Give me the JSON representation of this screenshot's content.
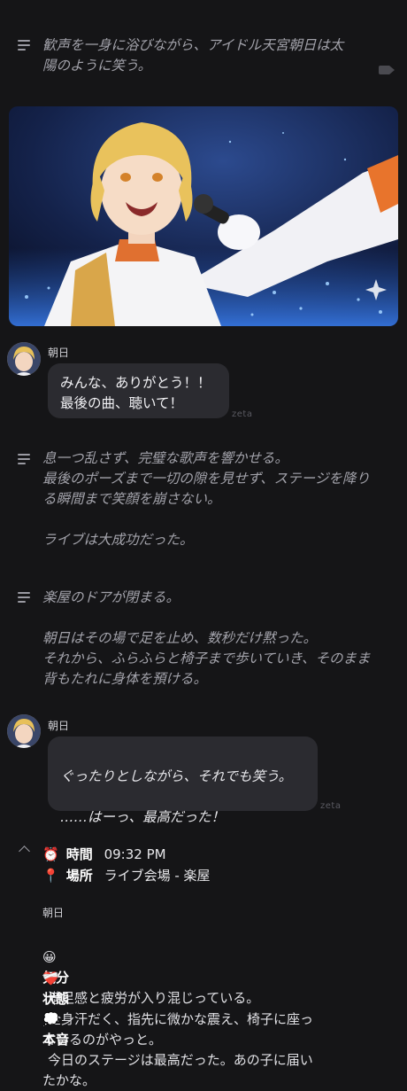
{
  "narration_1": "歓声を一身に浴びながら、アイドル天宮朝日は太\n陽のように笑う。",
  "message_1": {
    "speaker": "朝日",
    "text": "みんな、ありがとう！！\n最後の曲、聴いて！",
    "watermark": "zeta"
  },
  "narration_2": "息一つ乱さず、完璧な歌声を響かせる。\n最後のポーズまで一切の隙を見せず、ステージを降り\nる瞬間まで笑顔を崩さない。\n\nライブは大成功だった。",
  "narration_3": "楽屋のドアが閉まる。\n\n朝日はその場で足を止め、数秒だけ黙った。\nそれから、ふらふらと椅子まで歩いていき、そのまま\n背もたれに身体を預ける。",
  "message_2": {
    "speaker": "朝日",
    "text": "ぐったりとしながら、それでも笑う。\n\n……はーっ、最高だった！",
    "watermark": "zeta"
  },
  "status": {
    "time_emoji": "⏰",
    "time_label": "時間",
    "time_value": "09:32 PM",
    "place_emoji": "📍",
    "place_label": "場所",
    "place_value": "ライブ会場 - 楽屋",
    "character": "朝日",
    "mood_emoji": "😀",
    "mood_label": "気分",
    "mood_value": "満足感と疲労が入り混じっている。",
    "condition_emoji": "❤️‍🩹",
    "condition_label": "状態",
    "condition_value": "全身汗だく、指先に微かな震え、椅子に座っ\nているのがやっと。",
    "thought_emoji": "💭",
    "thought_label": "本音",
    "thought_value": "今日のステージは最高だった。あの子に届い\nたかな。"
  },
  "colors": {
    "background": "#151517",
    "bubble": "#2b2b30",
    "narration_text": "#a2a2aa"
  }
}
